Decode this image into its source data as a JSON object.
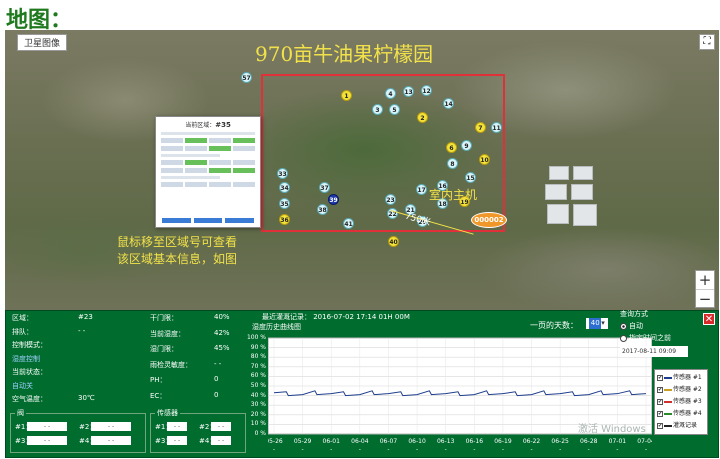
{
  "page": {
    "title": "地图："
  },
  "map": {
    "satellite_btn": "卫星图像",
    "fullscreen_icon": "fullscreen-icon",
    "zoom_in": "+",
    "zoom_out": "−",
    "orchard_title": "970亩牛油果柠檬园",
    "host_label": "室内主机",
    "host_id": "000002",
    "distance": "750米",
    "hint_line1": "鼠标移至区域号可查看",
    "hint_line2": "该区域基本信息，如图",
    "popup_title": "当前区域：",
    "popup_id": "#35",
    "markers": [
      {
        "label": "1",
        "kind": "y"
      },
      {
        "label": "2",
        "kind": "y"
      },
      {
        "label": "3",
        "kind": "c"
      },
      {
        "label": "4",
        "kind": "c"
      },
      {
        "label": "5",
        "kind": "c"
      },
      {
        "label": "6",
        "kind": "y"
      },
      {
        "label": "7",
        "kind": "y"
      },
      {
        "label": "8",
        "kind": "c"
      },
      {
        "label": "9",
        "kind": "c"
      },
      {
        "label": "10",
        "kind": "y"
      },
      {
        "label": "11",
        "kind": "c"
      },
      {
        "label": "12",
        "kind": "c"
      },
      {
        "label": "13",
        "kind": "c"
      },
      {
        "label": "14",
        "kind": "c"
      },
      {
        "label": "15",
        "kind": "c"
      },
      {
        "label": "16",
        "kind": "c"
      },
      {
        "label": "17",
        "kind": "c"
      },
      {
        "label": "18",
        "kind": "c"
      },
      {
        "label": "19",
        "kind": "y"
      },
      {
        "label": "20",
        "kind": "c"
      },
      {
        "label": "21",
        "kind": "c"
      },
      {
        "label": "22",
        "kind": "c"
      },
      {
        "label": "23",
        "kind": "c"
      },
      {
        "label": "33",
        "kind": "c"
      },
      {
        "label": "34",
        "kind": "c"
      },
      {
        "label": "35",
        "kind": "c"
      },
      {
        "label": "36",
        "kind": "y"
      },
      {
        "label": "37",
        "kind": "c"
      },
      {
        "label": "38",
        "kind": "c"
      },
      {
        "label": "39",
        "kind": "b"
      },
      {
        "label": "40",
        "kind": "y"
      },
      {
        "label": "41",
        "kind": "c"
      },
      {
        "label": "57",
        "kind": "c"
      }
    ]
  },
  "panel": {
    "close_icon": "close-icon",
    "left": [
      {
        "label": "区域：",
        "value": "#23"
      },
      {
        "label": "排队：",
        "value": "- -"
      },
      {
        "label": "控制模式：",
        "value": ""
      },
      {
        "label": "湿度控制",
        "value": ""
      },
      {
        "label": "当前状态：",
        "value": ""
      },
      {
        "label": "自动关",
        "value": ""
      },
      {
        "label": "空气温度：",
        "value": "30℃"
      }
    ],
    "middle": [
      {
        "label": "干门限：",
        "value": "40%"
      },
      {
        "label": "当前湿度：",
        "value": "42%"
      },
      {
        "label": "湿门限：",
        "value": "45%"
      },
      {
        "label": "雨检灵敏度：",
        "value": "- -"
      },
      {
        "label": "PH：",
        "value": "0"
      },
      {
        "label": "EC：",
        "value": "0"
      }
    ],
    "valve_box": {
      "title": "阀",
      "fields": [
        {
          "k": "#1：",
          "v": "- -"
        },
        {
          "k": "#2：",
          "v": "- -"
        },
        {
          "k": "#3：",
          "v": "- -"
        },
        {
          "k": "#4：",
          "v": "- -"
        }
      ]
    },
    "sensor_box": {
      "title": "传感器",
      "fields": [
        {
          "k": "#1：",
          "v": "- -"
        },
        {
          "k": "#2：",
          "v": "- -"
        },
        {
          "k": "#3：",
          "v": "- -"
        },
        {
          "k": "#4：",
          "v": "- -"
        }
      ]
    },
    "chart_header": "最近灌溉记录：  2016-07-02 17:14   01H 00M",
    "chart_subheader": "湿度历史曲线图",
    "pages_label": "一页的天数：",
    "pages_value": "40",
    "query": {
      "title": "查询方式",
      "options": [
        "自动",
        "指定时间之前"
      ],
      "selected": 0,
      "date": "2017-08-11 09:09"
    },
    "watermark": "激活 Windows"
  },
  "chart_data": {
    "type": "line",
    "title": "",
    "ylabel": "",
    "xlabel": "",
    "ylim": [
      0,
      100
    ],
    "y_ticks": [
      "0 %",
      "10 %",
      "20 %",
      "30 %",
      "40 %",
      "50 %",
      "60 %",
      "70 %",
      "80 %",
      "90 %",
      "100 %"
    ],
    "categories": [
      "05-26",
      "05-29",
      "06-01",
      "06-04",
      "06-07",
      "06-10",
      "06-13",
      "06-16",
      "06-19",
      "06-22",
      "06-25",
      "06-28",
      "07-01",
      "07-04"
    ],
    "series": [
      {
        "name": "传感器 #1",
        "color": "#1c3c8c",
        "values": [
          43,
          41,
          42,
          41,
          42,
          41,
          42,
          41,
          42,
          41,
          42,
          41,
          42,
          42
        ]
      },
      {
        "name": "传感器 #2",
        "color": "#c8a020",
        "values": []
      },
      {
        "name": "传感器 #3",
        "color": "#d03030",
        "values": []
      },
      {
        "name": "传感器 #4",
        "color": "#2a8a2a",
        "values": []
      },
      {
        "name": "灌溉记录",
        "color": "#222222",
        "values": []
      }
    ],
    "grid": true
  }
}
